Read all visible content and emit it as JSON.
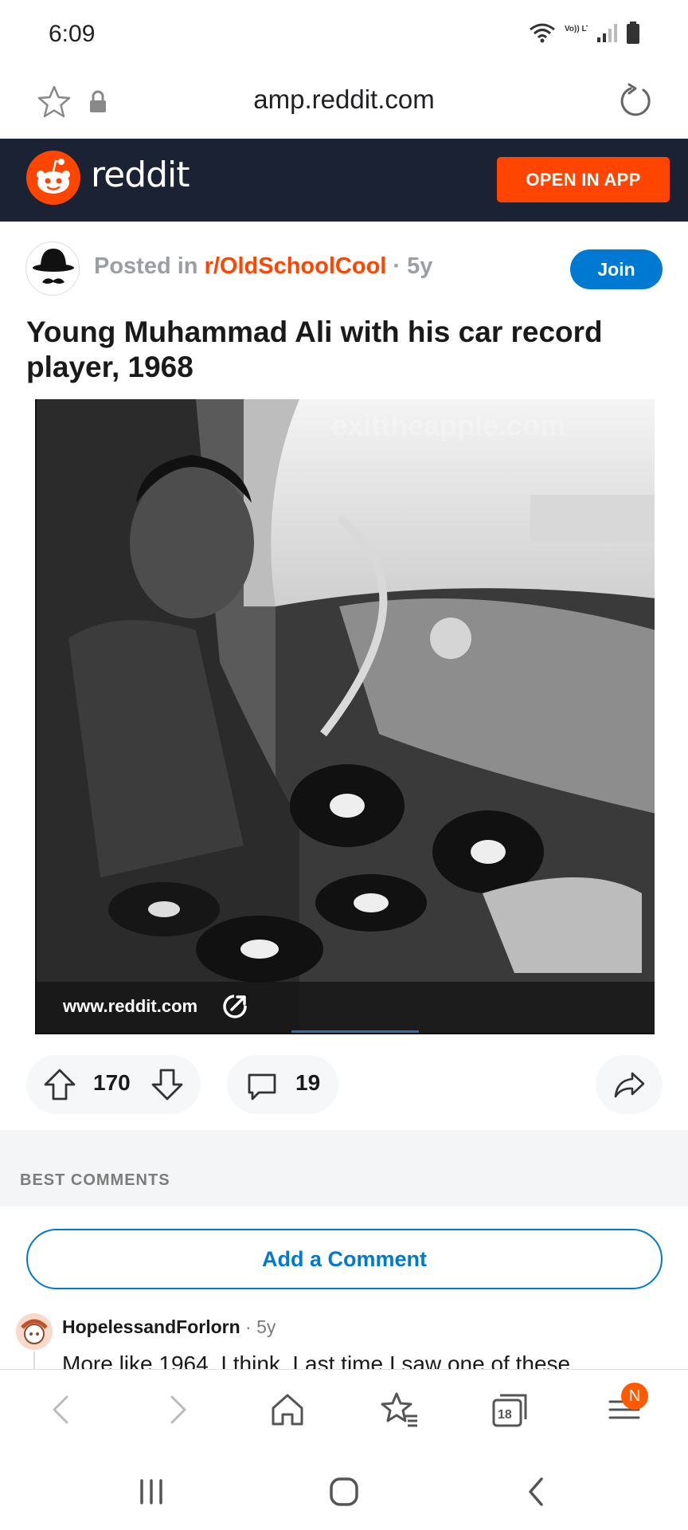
{
  "status_bar": {
    "time": "6:09",
    "network": "Vo)) LTE",
    "icons": [
      "wifi-icon",
      "signal-icon",
      "battery-icon"
    ]
  },
  "browser": {
    "url": "amp.reddit.com",
    "icons": [
      "star-icon",
      "lock-icon",
      "reload-icon"
    ]
  },
  "header": {
    "brand": "reddit",
    "open_in_app": "OPEN IN APP",
    "accent": "#ff4500",
    "background": "#1a2233"
  },
  "post": {
    "posted_in": "Posted in ",
    "subreddit": "r/OldSchoolCool",
    "age": " · 5y",
    "join_label": "Join",
    "title": "Young Muhammad Ali with his car record player, 1968",
    "image_link": "www.reddit.com",
    "watermark": "exittheapple.com",
    "upvotes": "170",
    "comments": "19"
  },
  "comments_section": {
    "best_label": "BEST COMMENTS",
    "add_comment_label": "Add a Comment",
    "first_comment": {
      "author": "HopelessandForlorn",
      "age": " · 5y",
      "text": "More like 1964, I think. Last time I saw one of these"
    }
  },
  "toolbar": {
    "tabs_count": "18",
    "menu_badge": "N",
    "icons": [
      "back-icon",
      "forward-icon",
      "home-icon",
      "bookmarks-icon",
      "tabs-icon",
      "menu-icon"
    ]
  },
  "system_nav": {
    "icons": [
      "recents-icon",
      "home-circle-icon",
      "back-icon"
    ]
  }
}
